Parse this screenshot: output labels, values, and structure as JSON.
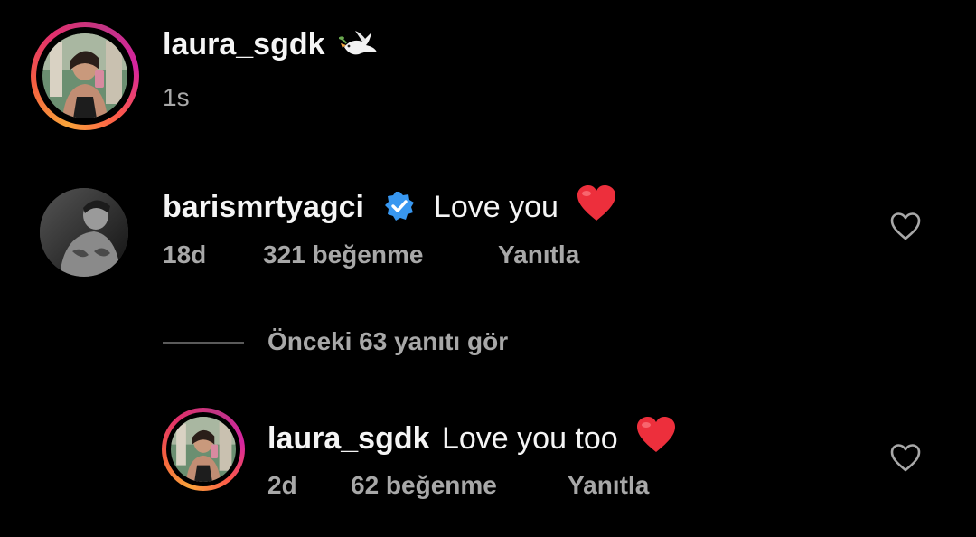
{
  "post": {
    "author": "laura_sgdk",
    "author_emoji": "dove-icon",
    "time": "1s"
  },
  "comment": {
    "author": "barismrtyagci",
    "verified": true,
    "text": "Love you",
    "time": "18d",
    "likes": "321 beğenme",
    "reply_label": "Yanıtla"
  },
  "replies_toggle": {
    "label": "Önceki 63 yanıtı gör"
  },
  "reply": {
    "author": "laura_sgdk",
    "text": "Love you too",
    "time": "2d",
    "likes": "62 beğenme",
    "reply_label": "Yanıtla"
  },
  "colors": {
    "background": "#000000",
    "text": "#f5f5f5",
    "secondary_text": "#a8a8a8",
    "verified_blue": "#3897f0",
    "heart_red": "#ed4956"
  }
}
